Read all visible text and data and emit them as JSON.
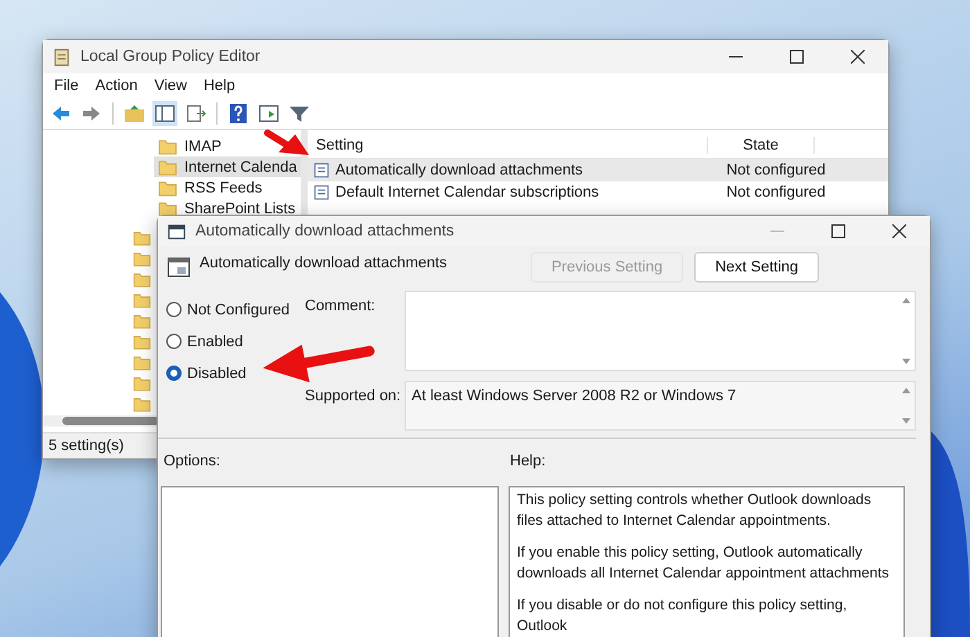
{
  "main_window": {
    "title": "Local Group Policy Editor",
    "menu": [
      "File",
      "Action",
      "View",
      "Help"
    ],
    "tree": [
      {
        "label": "IMAP",
        "selected": false
      },
      {
        "label": "Internet Calenda",
        "selected": true
      },
      {
        "label": "RSS Feeds",
        "selected": false
      },
      {
        "label": "SharePoint Lists",
        "selected": false
      }
    ],
    "list": {
      "columns": [
        "Setting",
        "State"
      ],
      "rows": [
        {
          "setting": "Automatically download attachments",
          "state": "Not configured",
          "selected": true
        },
        {
          "setting": "Default Internet Calendar subscriptions",
          "state": "Not configured",
          "selected": false
        }
      ]
    },
    "status_bar": "5 setting(s)"
  },
  "dialog": {
    "title": "Automatically download attachments",
    "heading": "Automatically download attachments",
    "buttons": [
      {
        "label": "Previous Setting",
        "disabled": true
      },
      {
        "label": "Next Setting",
        "disabled": false
      }
    ],
    "radios": [
      {
        "label": "Not Configured",
        "selected": false
      },
      {
        "label": "Enabled",
        "selected": false
      },
      {
        "label": "Disabled",
        "selected": true
      }
    ],
    "comment_label": "Comment:",
    "supported_label": "Supported on:",
    "supported_value": "At least Windows Server 2008 R2 or Windows 7",
    "options_label": "Options:",
    "help_label": "Help:",
    "help_paragraphs": [
      "This policy setting controls whether Outlook downloads files attached to Internet Calendar appointments.",
      "If you enable this policy setting, Outlook automatically downloads all Internet Calendar appointment attachments",
      "If you disable or do not configure this policy setting, Outlook"
    ]
  }
}
